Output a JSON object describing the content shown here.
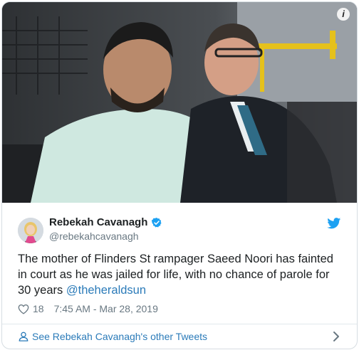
{
  "tweet": {
    "author_name": "Rebekah Cavanagh",
    "handle": "@rebekahcavanagh",
    "text_before_mention": "The mother of Flinders St rampager Saeed Noori has fainted in court as he was jailed for life, with no chance of parole for 30 years ",
    "mention": "@theheraldsun",
    "like_count": "18",
    "timestamp": "7:45 AM - Mar 28, 2019"
  },
  "footer": {
    "see_more_label": "See Rebekah Cavanagh's other Tweets"
  },
  "media": {
    "info_label": "i"
  },
  "colors": {
    "link_blue": "#2b7bb9",
    "twitter_blue": "#1da1f2",
    "text": "#1c2022",
    "muted": "#697882"
  }
}
